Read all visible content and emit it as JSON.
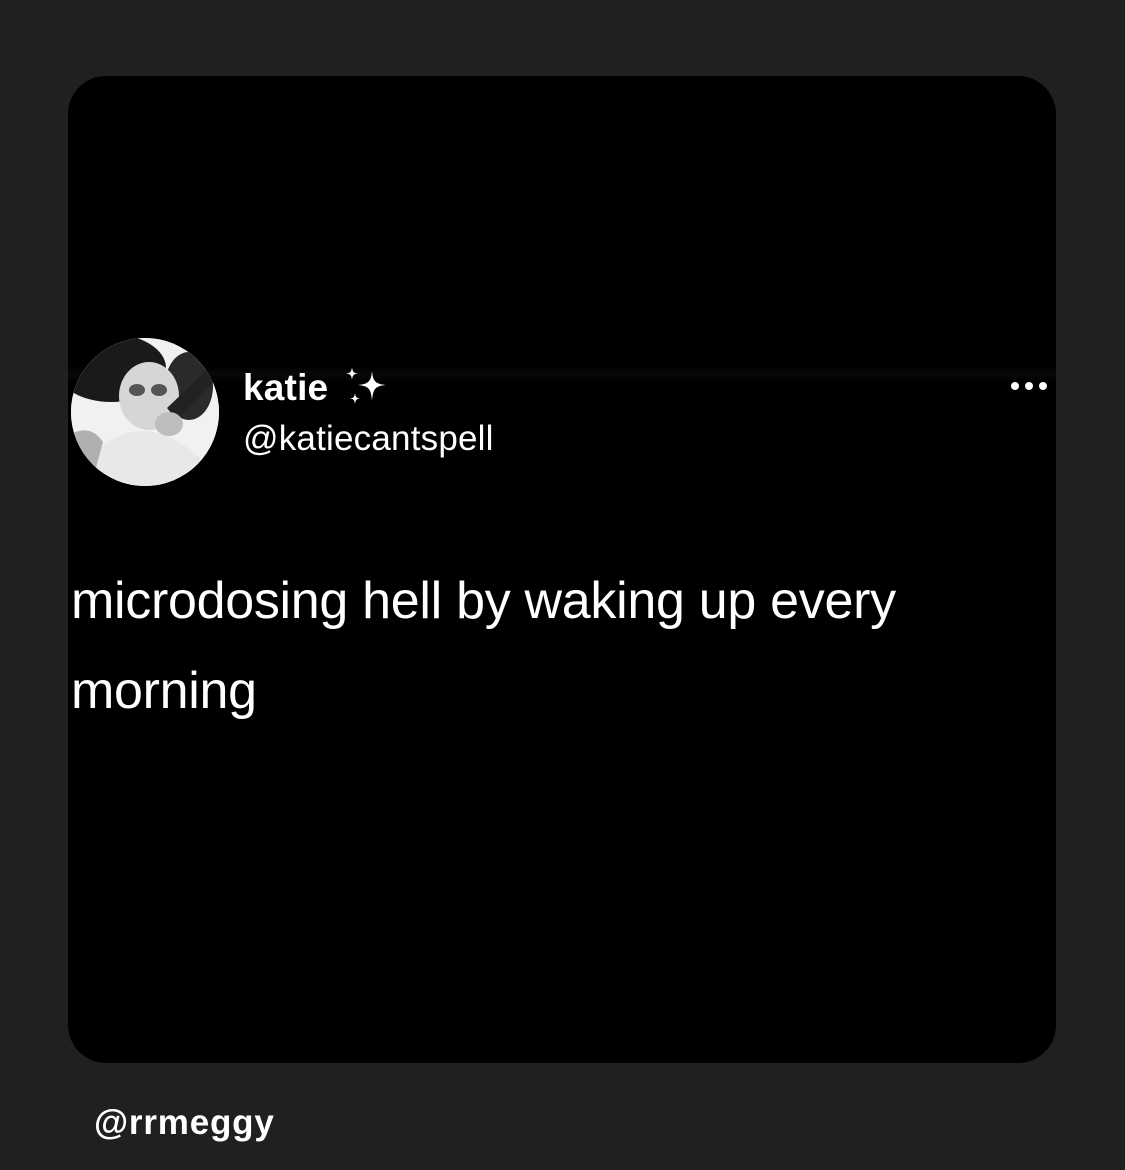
{
  "tweet": {
    "display_name": "katie",
    "name_emoji_icon": "sparkles-icon",
    "handle": "@katiecantspell",
    "text": "microdosing hell by waking up every morning",
    "more_icon": "more-options-icon"
  },
  "credit": "@rrmeggy",
  "colors": {
    "page_background": "#202020",
    "card_background": "#000000",
    "text": "#ffffff"
  }
}
